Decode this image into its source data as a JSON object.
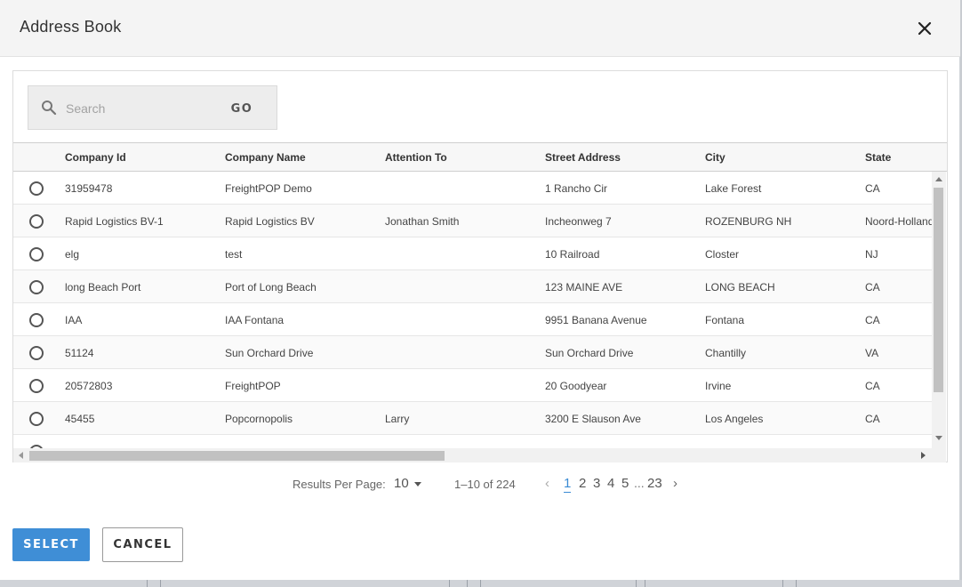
{
  "dialog": {
    "title": "Address Book",
    "close_icon": "close-icon"
  },
  "search": {
    "placeholder": "Search",
    "value": "",
    "go_label": "GO",
    "icon": "search-icon"
  },
  "table": {
    "columns": [
      "Company Id",
      "Company Name",
      "Attention To",
      "Street Address",
      "City",
      "State"
    ],
    "rows": [
      [
        "31959478",
        "FreightPOP Demo",
        "",
        "1 Rancho Cir",
        "Lake Forest",
        "CA"
      ],
      [
        "Rapid Logistics BV-1",
        "Rapid Logistics BV",
        "Jonathan Smith",
        "Incheonweg 7",
        "ROZENBURG NH",
        "Noord-Holland"
      ],
      [
        "elg",
        "test",
        "",
        "10 Railroad",
        "Closter",
        "NJ"
      ],
      [
        "long Beach Port",
        "Port of Long Beach",
        "",
        "123 MAINE AVE",
        "LONG BEACH",
        "CA"
      ],
      [
        "IAA",
        "IAA Fontana",
        "",
        "9951 Banana Avenue",
        "Fontana",
        "CA"
      ],
      [
        "51124",
        "Sun Orchard Drive",
        "",
        "Sun Orchard Drive",
        "Chantilly",
        "VA"
      ],
      [
        "20572803",
        "FreightPOP",
        "",
        "20 Goodyear",
        "Irvine",
        "CA"
      ],
      [
        "45455",
        "Popcornopolis",
        "Larry",
        "3200 E Slauson Ave",
        "Los Angeles",
        "CA"
      ]
    ]
  },
  "pager": {
    "results_per_page_label": "Results Per Page:",
    "results_per_page": "10",
    "range_text": "1–10 of 224",
    "prev": "‹",
    "next": "›",
    "pages": [
      "1",
      "2",
      "3",
      "4",
      "5"
    ],
    "ellipsis": "...",
    "last_page": "23",
    "current_page": "1"
  },
  "footer": {
    "select_label": "SELECT",
    "cancel_label": "CANCEL"
  },
  "colors": {
    "primary": "#3f8ed6",
    "active_page": "#3a8bd4"
  }
}
